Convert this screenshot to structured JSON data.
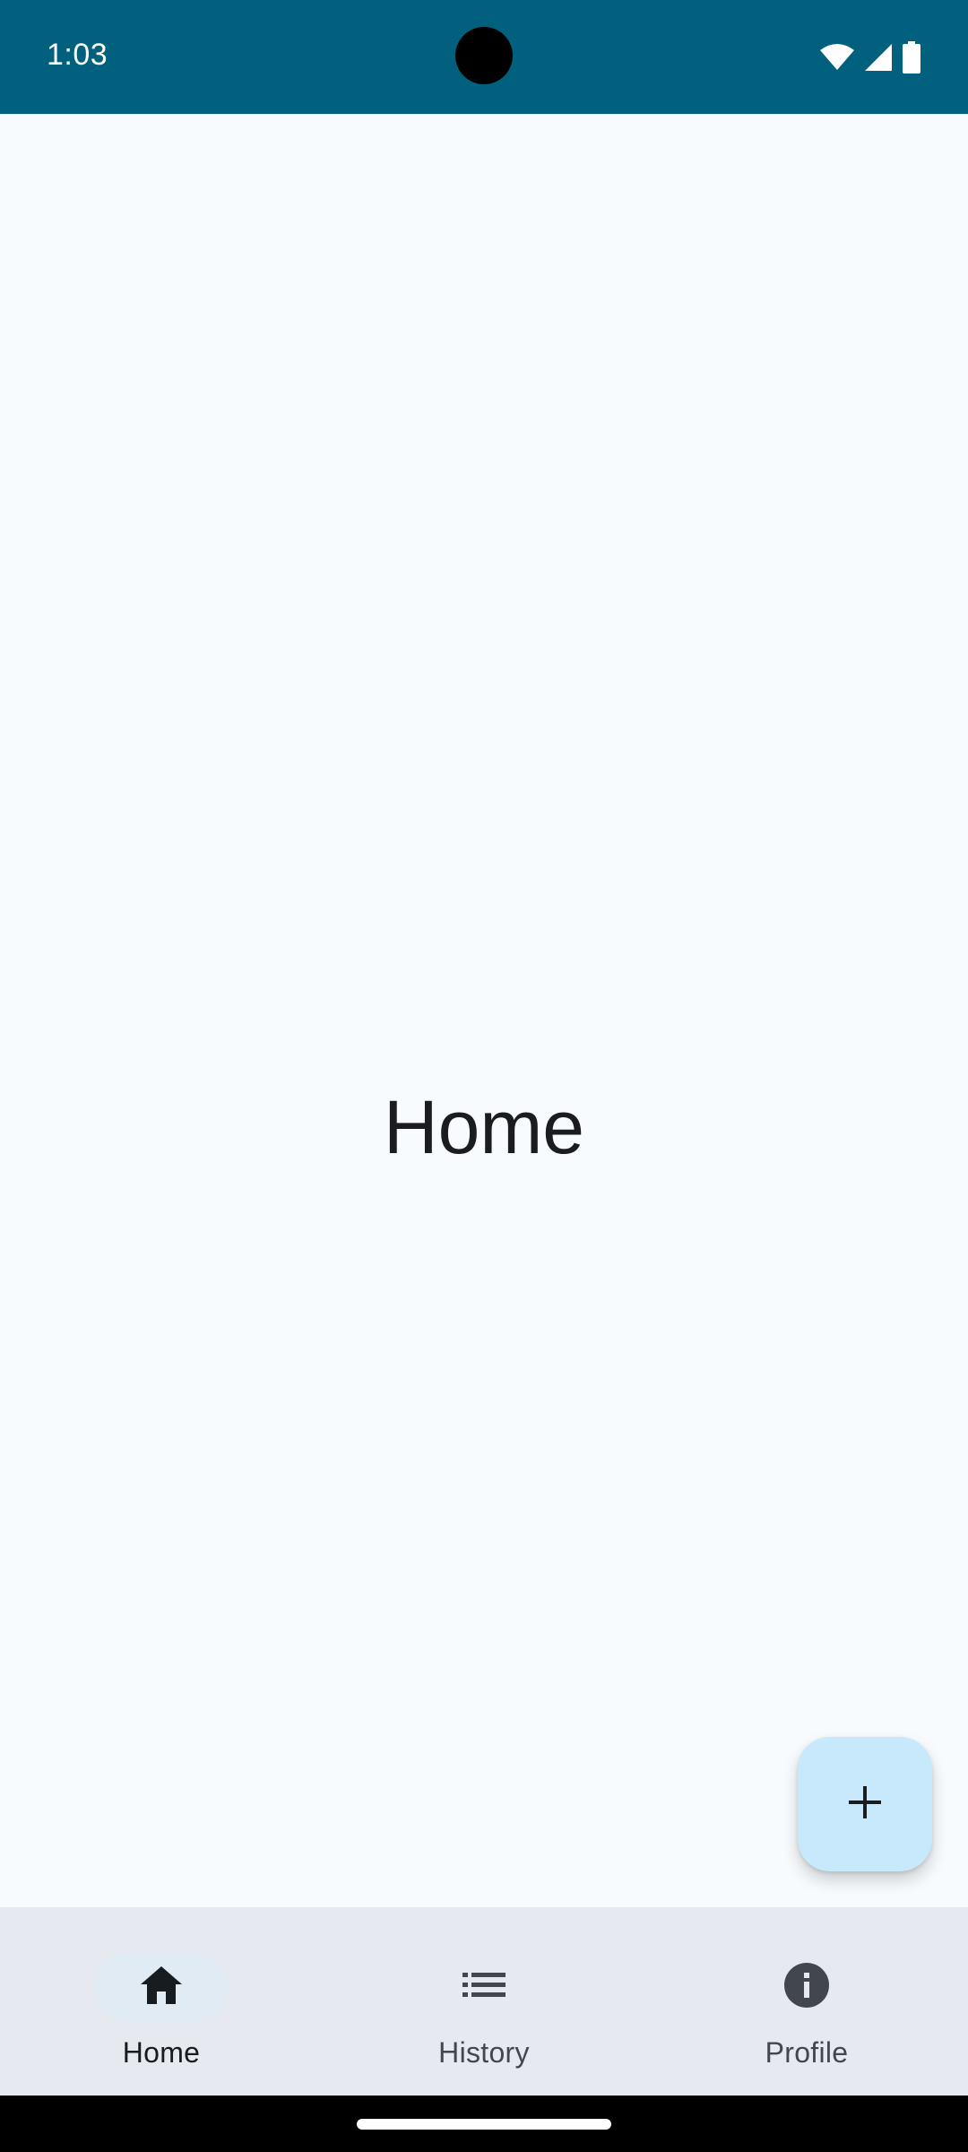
{
  "status_bar": {
    "time": "1:03",
    "icons": [
      "wifi-icon",
      "cellular-signal-icon",
      "battery-icon"
    ],
    "background": "#00607d"
  },
  "main": {
    "title": "Home"
  },
  "fab": {
    "icon": "plus-icon",
    "background": "#c8e9fb"
  },
  "bottom_nav": {
    "items": [
      {
        "label": "Home",
        "icon": "home-icon",
        "selected": true
      },
      {
        "label": "History",
        "icon": "list-icon",
        "selected": false
      },
      {
        "label": "Profile",
        "icon": "info-icon",
        "selected": false
      }
    ]
  }
}
